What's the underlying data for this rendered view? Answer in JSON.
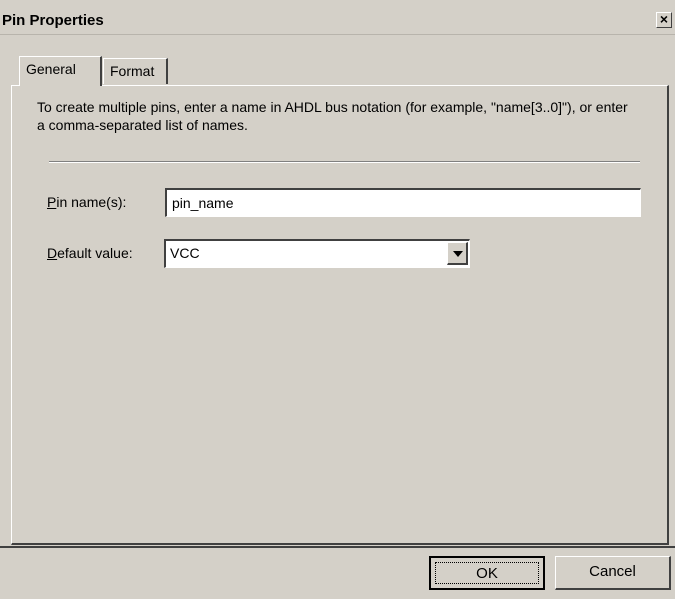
{
  "window": {
    "title": "Pin Properties",
    "close_label": "×"
  },
  "tabs": [
    {
      "label": "General",
      "active": true
    },
    {
      "label": "Format",
      "active": false
    }
  ],
  "general": {
    "intro_text": "To create multiple pins, enter a name in AHDL bus notation (for example, \"name[3..0]\"), or enter a comma-separated list of names.",
    "pin_name_label_mnemonic": "P",
    "pin_name_label_rest": "in name(s):",
    "pin_name_value": "pin_name",
    "default_value_label_mnemonic": "D",
    "default_value_label_rest": "efault value:",
    "default_value_selected": "VCC"
  },
  "buttons": {
    "ok": "OK",
    "cancel": "Cancel"
  },
  "colors": {
    "face": "#d4d0c8",
    "shadow": "#404040",
    "highlight": "#ffffff"
  }
}
